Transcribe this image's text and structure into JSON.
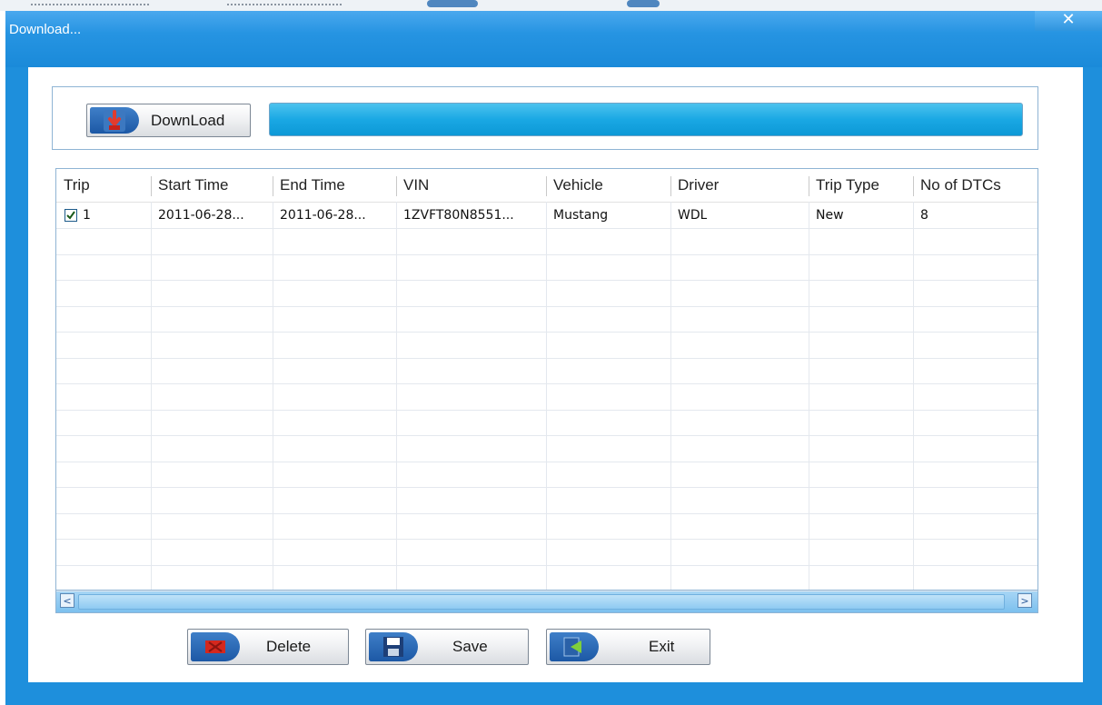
{
  "window": {
    "title": "Download..."
  },
  "toolbar": {
    "download_label": "DownLoad",
    "progress_percent": 100
  },
  "table": {
    "columns": [
      "Trip",
      "Start Time",
      "End Time",
      "VIN",
      "Vehicle",
      "Driver",
      "Trip Type",
      "No of DTCs"
    ],
    "rows": [
      {
        "trip": "1",
        "checked": true,
        "start_time": "2011-06-28...",
        "end_time": "2011-06-28...",
        "vin": "1ZVFT80N8551...",
        "vehicle": "Mustang",
        "driver": "WDL",
        "trip_type": "New",
        "dtcs": "8"
      }
    ]
  },
  "footer": {
    "delete_label": "Delete",
    "save_label": "Save",
    "exit_label": "Exit"
  },
  "icons": {
    "close": "close-icon",
    "download": "download-icon",
    "delete": "delete-icon",
    "save": "save-icon",
    "exit": "exit-icon",
    "check": "check-icon"
  },
  "colors": {
    "window_frame": "#1e8fdc",
    "progress": "#1aa8e4",
    "icon_bg": "#1c58a5"
  }
}
